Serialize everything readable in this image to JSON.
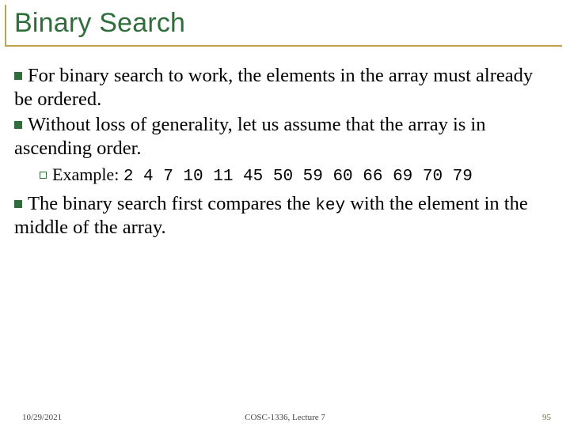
{
  "title": "Binary Search",
  "bullets": {
    "b1": "For binary search to work, the elements in the array must already be ordered.",
    "b2": "Without loss of generality, let us assume that the array is in ascending order.",
    "example_label": "Example: ",
    "example_values": "2 4 7 10 11 45 50 59 60 66 69 70 79",
    "b3a": "The binary search first compares the ",
    "b3_key": "key",
    "b3b": " with the element in the middle of the array."
  },
  "footer": {
    "date": "10/29/2021",
    "course": "COSC-1336, Lecture 7",
    "page": "95"
  }
}
